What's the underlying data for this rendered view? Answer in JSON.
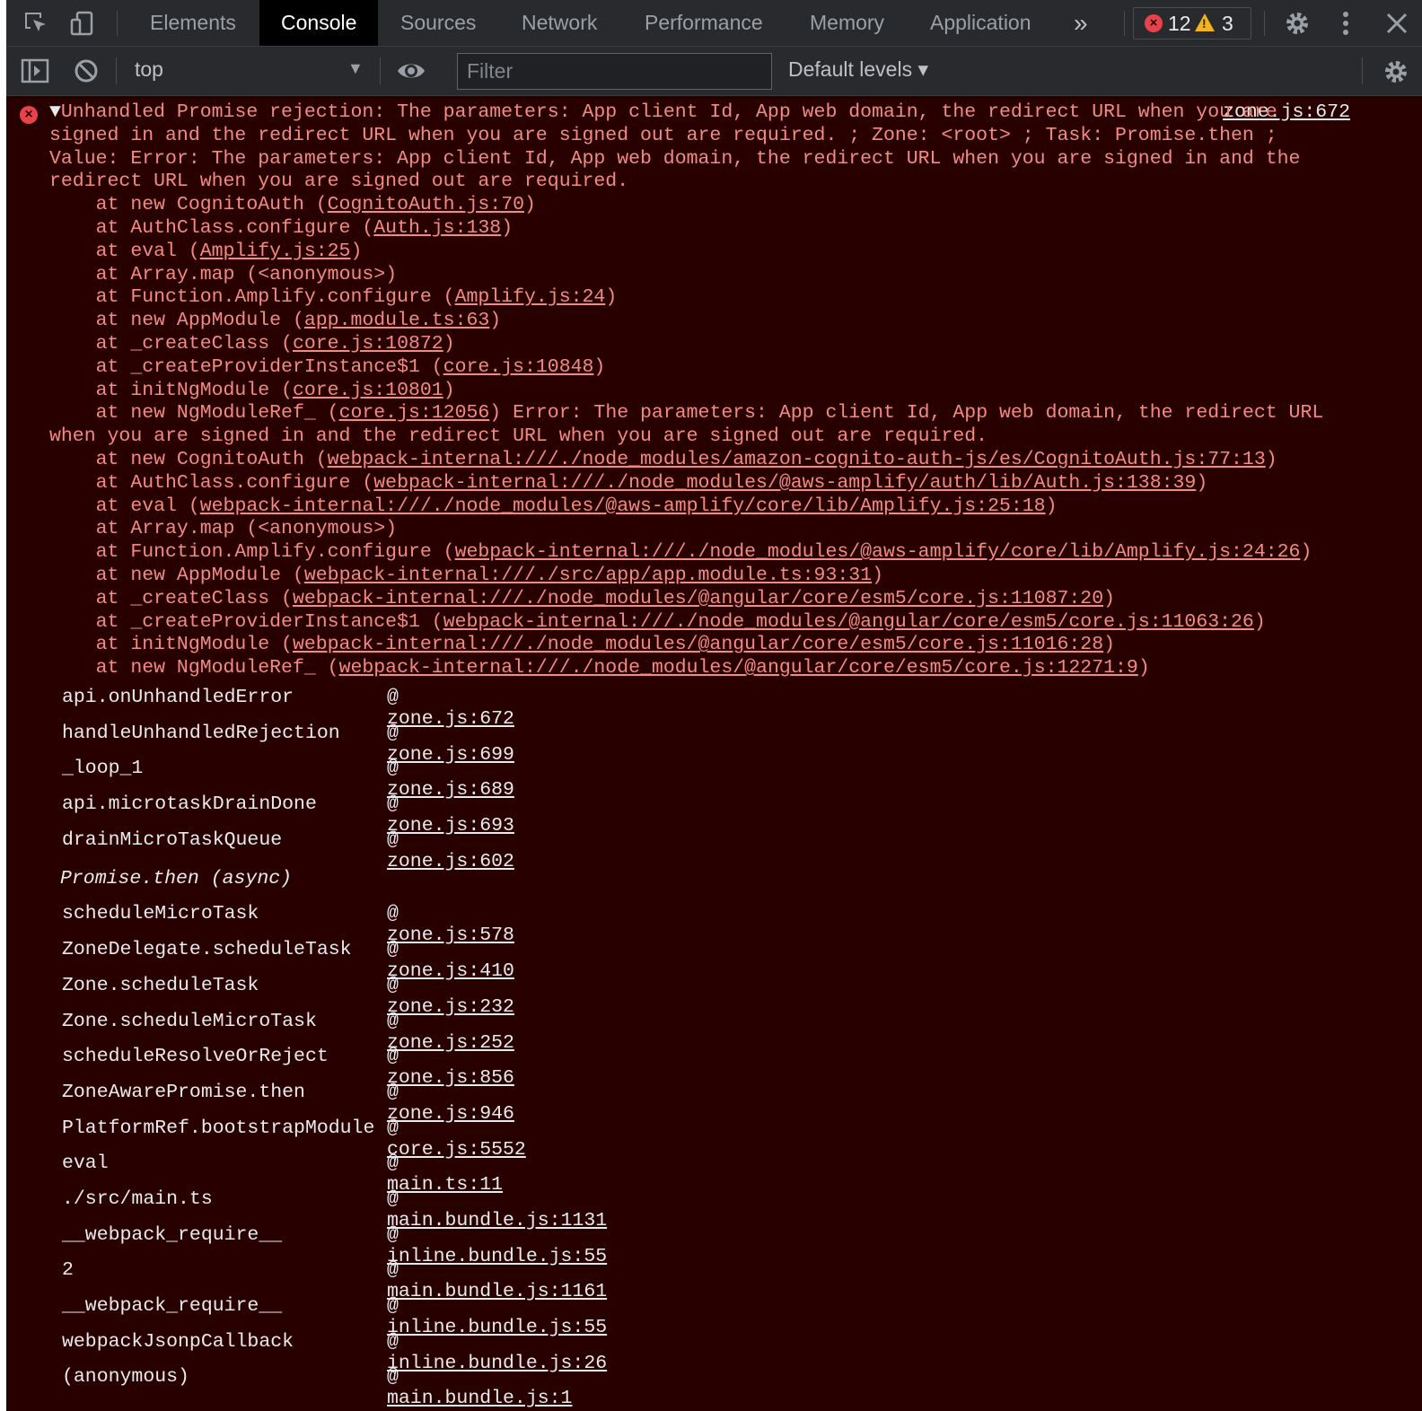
{
  "tabs": {
    "elements": "Elements",
    "console": "Console",
    "sources": "Sources",
    "network": "Network",
    "performance": "Performance",
    "memory": "Memory",
    "application": "Application",
    "more": "»"
  },
  "badges": {
    "errors": "12",
    "warnings": "3"
  },
  "toolbar": {
    "context": "top",
    "filter_placeholder": "Filter",
    "levels": "Default levels ▾"
  },
  "colors": {
    "error_bg": "#290000",
    "error_text": "#f28b82",
    "link": "#e8eaed",
    "error_icon": "#e8434b",
    "warning_icon": "#f2b31c"
  },
  "message": {
    "summary": "Unhandled Promise rejection: The parameters: App client Id, App web domain, the redirect URL when you are signed in and the redirect URL when you are signed out are required. ; Zone: <root> ; Task: Promise.then ; Value: Error: The parameters: App client Id, App web domain, the redirect URL when you are signed in and the redirect URL when you are signed out are required.",
    "source": "zone.js:672",
    "trace1": [
      {
        "fn": "at new CognitoAuth",
        "src": "CognitoAuth.js:70"
      },
      {
        "fn": "at AuthClass.configure",
        "src": "Auth.js:138"
      },
      {
        "fn": "at eval",
        "src": "Amplify.js:25"
      },
      {
        "fn": "at Array.map",
        "src": "<anonymous>"
      },
      {
        "fn": "at Function.Amplify.configure",
        "src": "Amplify.js:24"
      },
      {
        "fn": "at new AppModule",
        "src": "app.module.ts:63"
      },
      {
        "fn": "at _createClass",
        "src": "core.js:10872"
      },
      {
        "fn": "at _createProviderInstance$1",
        "src": "core.js:10848"
      },
      {
        "fn": "at initNgModule",
        "src": "core.js:10801"
      },
      {
        "fn": "at new NgModuleRef_",
        "src": "core.js:12056"
      }
    ],
    "error2": "Error: The parameters: App client Id, App web domain, the redirect URL when you are signed in and the redirect URL when you are signed out are required.",
    "trace2": [
      {
        "fn": "at new CognitoAuth",
        "src": "webpack-internal:///./node_modules/amazon-cognito-auth-js/es/CognitoAuth.js:77:13"
      },
      {
        "fn": "at AuthClass.configure",
        "src": "webpack-internal:///./node_modules/@aws-amplify/auth/lib/Auth.js:138:39"
      },
      {
        "fn": "at eval",
        "src": "webpack-internal:///./node_modules/@aws-amplify/core/lib/Amplify.js:25:18"
      },
      {
        "fn": "at Array.map",
        "src": "<anonymous>"
      },
      {
        "fn": "at Function.Amplify.configure",
        "src": "webpack-internal:///./node_modules/@aws-amplify/core/lib/Amplify.js:24:26"
      },
      {
        "fn": "at new AppModule",
        "src": "webpack-internal:///./src/app/app.module.ts:93:31"
      },
      {
        "fn": "at _createClass",
        "src": "webpack-internal:///./node_modules/@angular/core/esm5/core.js:11087:20"
      },
      {
        "fn": "at _createProviderInstance$1",
        "src": "webpack-internal:///./node_modules/@angular/core/esm5/core.js:11063:26"
      },
      {
        "fn": "at initNgModule",
        "src": "webpack-internal:///./node_modules/@angular/core/esm5/core.js:11016:28"
      },
      {
        "fn": "at new NgModuleRef_",
        "src": "webpack-internal:///./node_modules/@angular/core/esm5/core.js:12271:9"
      }
    ]
  },
  "stack_group1": [
    {
      "fn": "api.onUnhandledError",
      "src": "zone.js:672"
    },
    {
      "fn": "handleUnhandledRejection",
      "src": "zone.js:699"
    },
    {
      "fn": "_loop_1",
      "src": "zone.js:689"
    },
    {
      "fn": "api.microtaskDrainDone",
      "src": "zone.js:693"
    },
    {
      "fn": "drainMicroTaskQueue",
      "src": "zone.js:602"
    }
  ],
  "async_label": "Promise.then (async)",
  "stack_group2": [
    {
      "fn": "scheduleMicroTask",
      "src": "zone.js:578"
    },
    {
      "fn": "ZoneDelegate.scheduleTask",
      "src": "zone.js:410"
    },
    {
      "fn": "Zone.scheduleTask",
      "src": "zone.js:232"
    },
    {
      "fn": "Zone.scheduleMicroTask",
      "src": "zone.js:252"
    },
    {
      "fn": "scheduleResolveOrReject",
      "src": "zone.js:856"
    },
    {
      "fn": "ZoneAwarePromise.then",
      "src": "zone.js:946"
    },
    {
      "fn": "PlatformRef.bootstrapModule",
      "src": "core.js:5552"
    },
    {
      "fn": "eval",
      "src": "main.ts:11"
    },
    {
      "fn": "./src/main.ts",
      "src": "main.bundle.js:1131"
    },
    {
      "fn": "__webpack_require__",
      "src": "inline.bundle.js:55"
    },
    {
      "fn": "2",
      "src": "main.bundle.js:1161"
    },
    {
      "fn": "__webpack_require__",
      "src": "inline.bundle.js:55"
    },
    {
      "fn": "webpackJsonpCallback",
      "src": "inline.bundle.js:26"
    },
    {
      "fn": "(anonymous)",
      "src": "main.bundle.js:1"
    }
  ]
}
